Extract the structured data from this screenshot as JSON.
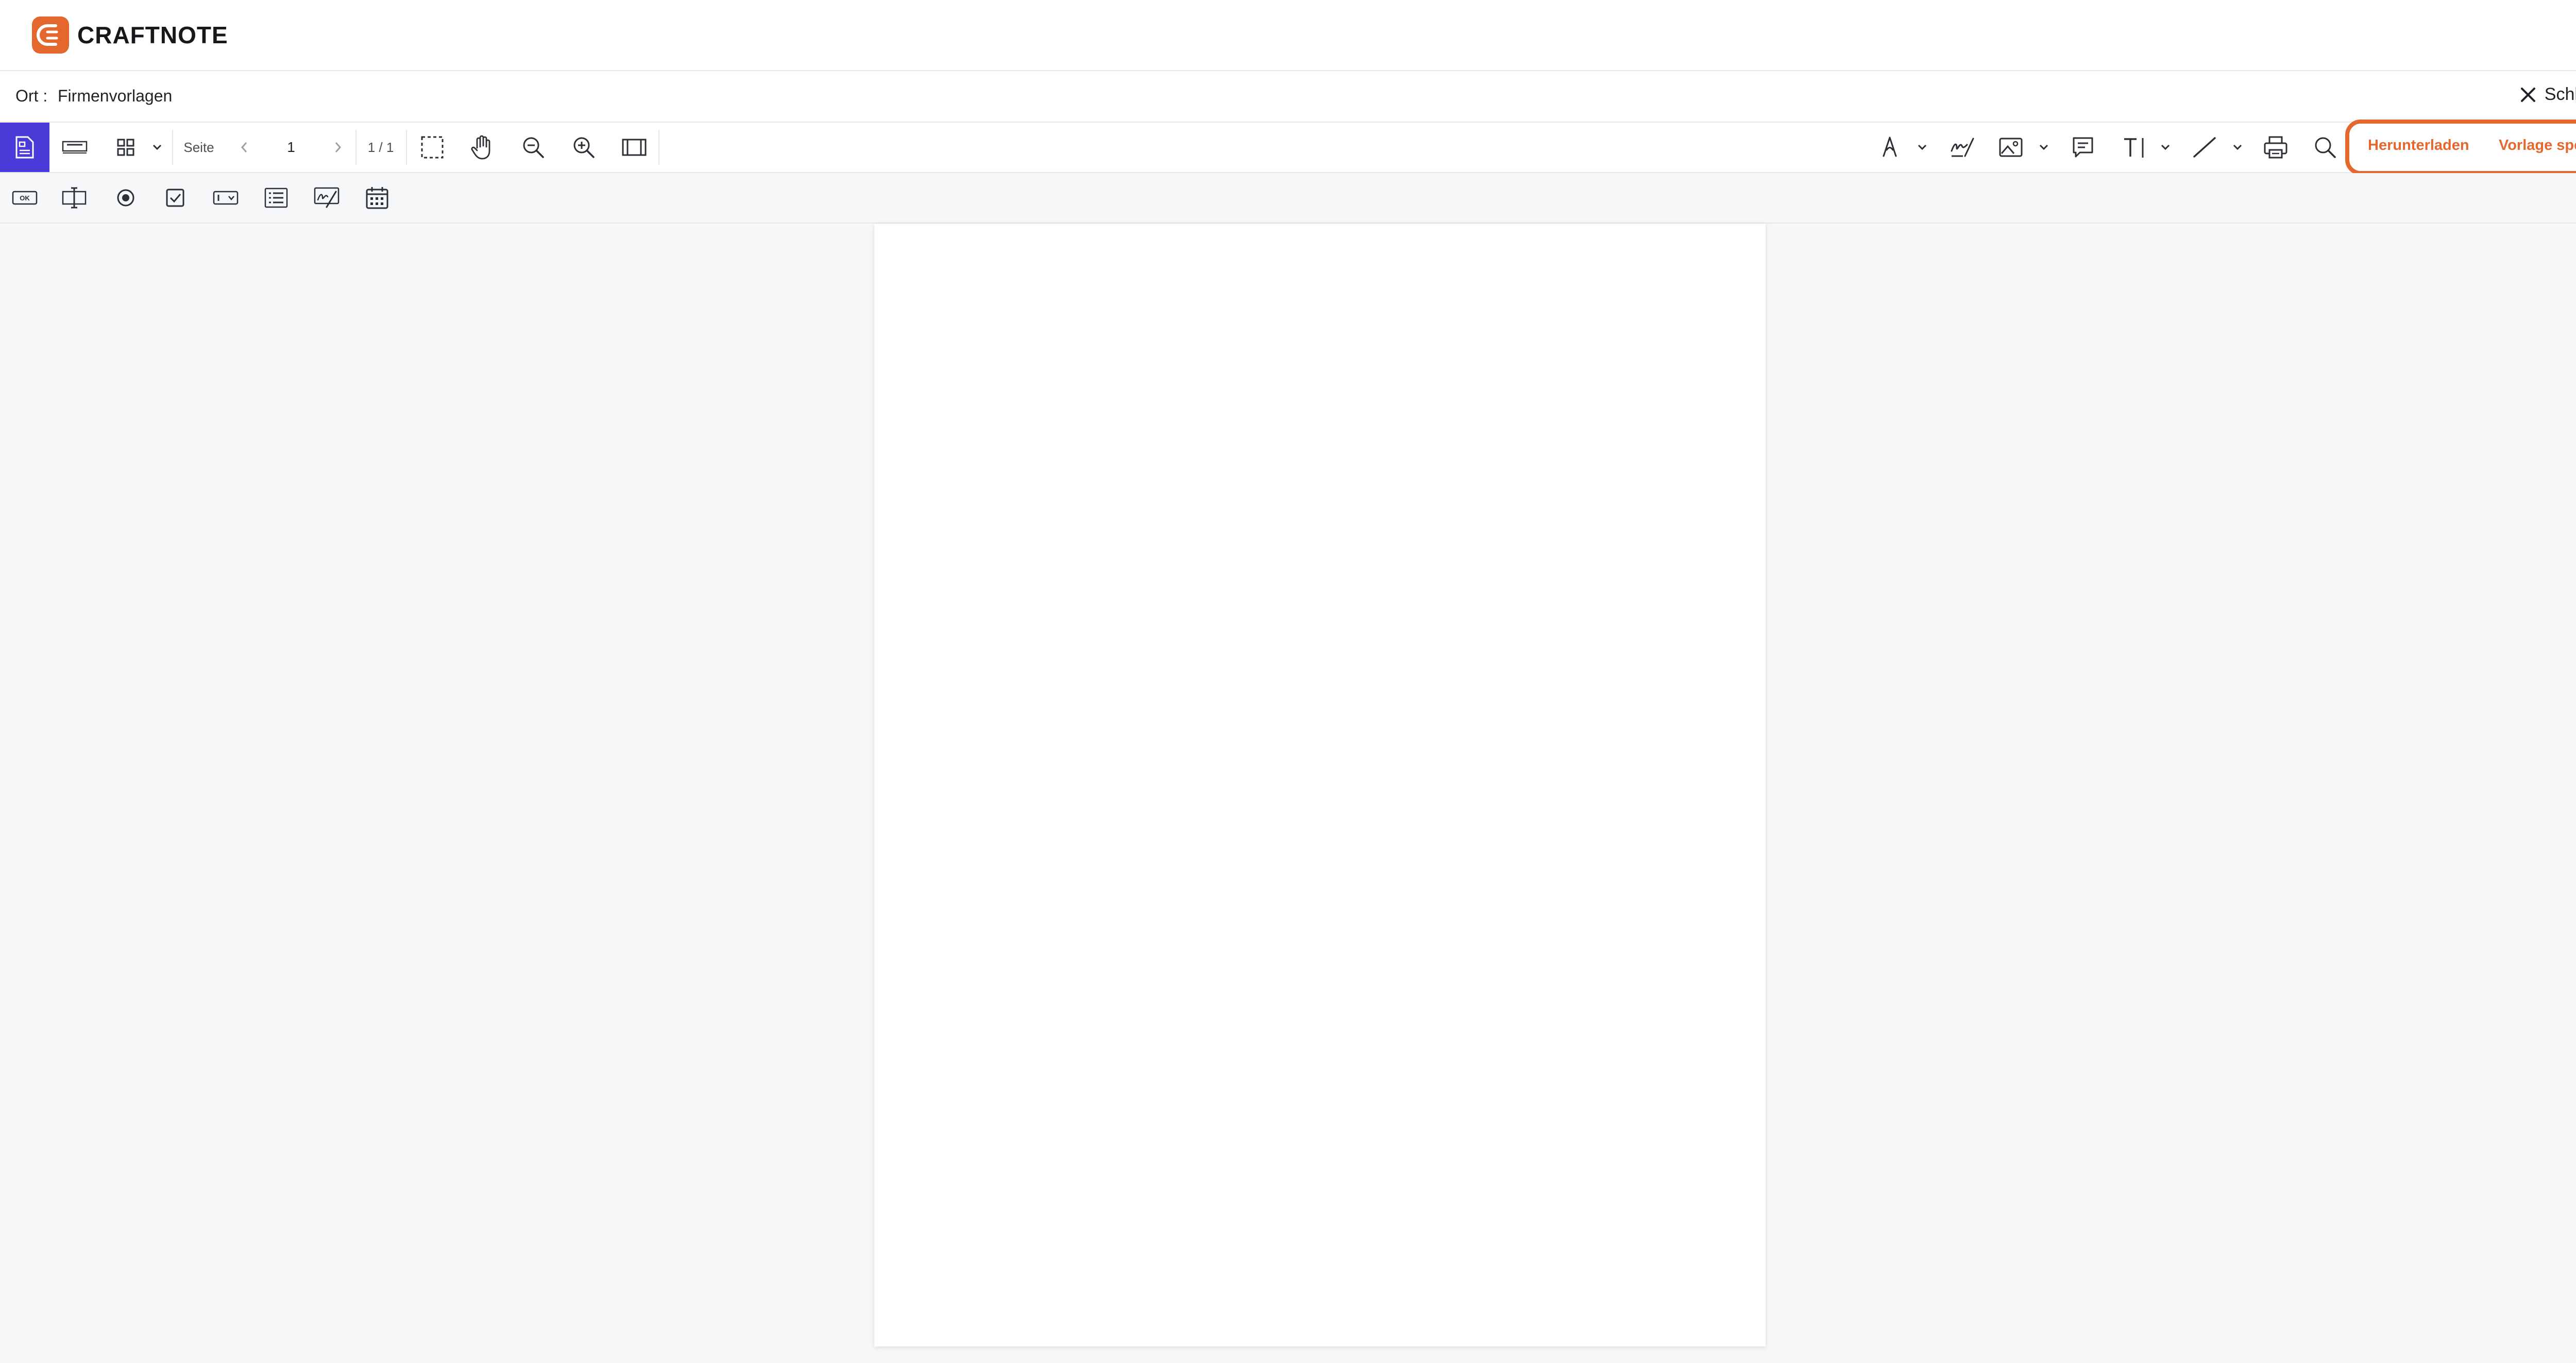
{
  "app": {
    "brand": "CRAFTNOTE",
    "brand_color": "#e4672e",
    "accent_color": "#4a3ad8"
  },
  "location": {
    "label": "Ort :",
    "value": "Firmenvorlagen"
  },
  "close": {
    "label": "Schließen",
    "icon": "close-icon"
  },
  "toolbar": {
    "page_label": "Seite",
    "page_input_value": "1",
    "page_count": "1 / 1",
    "left_icons": [
      "document-panel-icon",
      "annotation-label-icon",
      "thumbnails-grid-icon",
      "chevron-down-icon",
      "chevron-left-icon",
      "chevron-right-icon",
      "marquee-select-icon",
      "pan-hand-icon",
      "zoom-out-icon",
      "zoom-in-icon",
      "fit-page-icon"
    ],
    "right_icons": [
      "pen-icon",
      "chevron-down-icon",
      "signature-icon",
      "image-icon",
      "chevron-down-icon",
      "comment-icon",
      "text-tool-icon",
      "chevron-down-icon",
      "line-tool-icon",
      "chevron-down-icon",
      "print-icon",
      "search-icon"
    ]
  },
  "actions": {
    "download": "Herunterladen",
    "save_template": "Vorlage speichern"
  },
  "form_tools": [
    "button-field-icon",
    "text-field-icon",
    "radio-button-icon",
    "checkbox-icon",
    "dropdown-field-icon",
    "list-box-icon",
    "signature-field-icon",
    "date-field-icon"
  ],
  "form_tool_labels": {
    "button": "OK"
  }
}
